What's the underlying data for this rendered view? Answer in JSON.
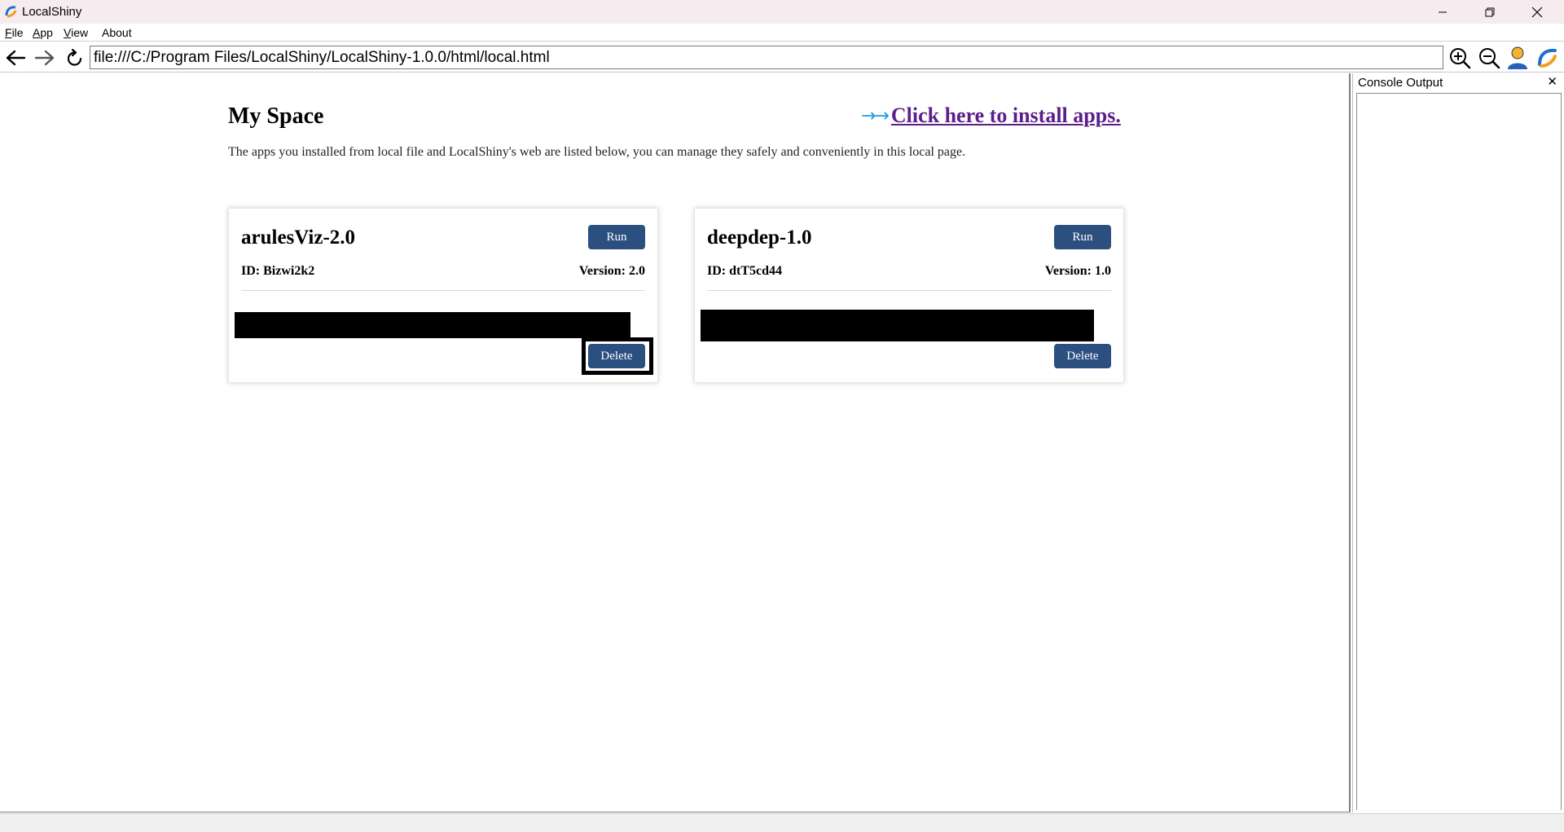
{
  "window": {
    "title": "LocalShiny",
    "icons": {
      "app": "localshiny-logo-icon",
      "minimize": "minimize-icon",
      "maximize": "restore-icon",
      "close": "close-icon"
    }
  },
  "menu": {
    "items": [
      {
        "key": "F",
        "rest": "ile"
      },
      {
        "key": "A",
        "rest": "pp"
      },
      {
        "key": "V",
        "rest": "iew"
      },
      {
        "key": "",
        "rest": "About"
      }
    ]
  },
  "toolbar": {
    "url": "file:///C:/Program Files/LocalShiny/LocalShiny-1.0.0/html/local.html",
    "icons": [
      "back-arrow-icon",
      "forward-arrow-icon",
      "reload-icon",
      "zoom-in-icon",
      "zoom-out-icon",
      "user-icon",
      "localshiny-logo-icon"
    ]
  },
  "page": {
    "heading": "My Space",
    "install_link": "Click here to install apps.",
    "install_arrows": "→→",
    "description": "The apps you installed from local file and LocalShiny's web are listed below, you can manage they safely and conveniently in this local page."
  },
  "apps": [
    {
      "name": "arulesViz-2.0",
      "id": "ID: Bizwi2k2",
      "version": "Version: 2.0",
      "run_label": "Run",
      "delete_label": "Delete"
    },
    {
      "name": "deepdep-1.0",
      "id": "ID: dtT5cd44",
      "version": "Version: 1.0",
      "run_label": "Run",
      "delete_label": "Delete"
    }
  ],
  "console": {
    "title": "Console Output",
    "close_glyph": "✕"
  },
  "colors": {
    "titlebar_bg": "#f6ecef",
    "button_bg": "#2b4f7e",
    "link": "#5b1e8a",
    "arrow": "#1a9ee0"
  }
}
